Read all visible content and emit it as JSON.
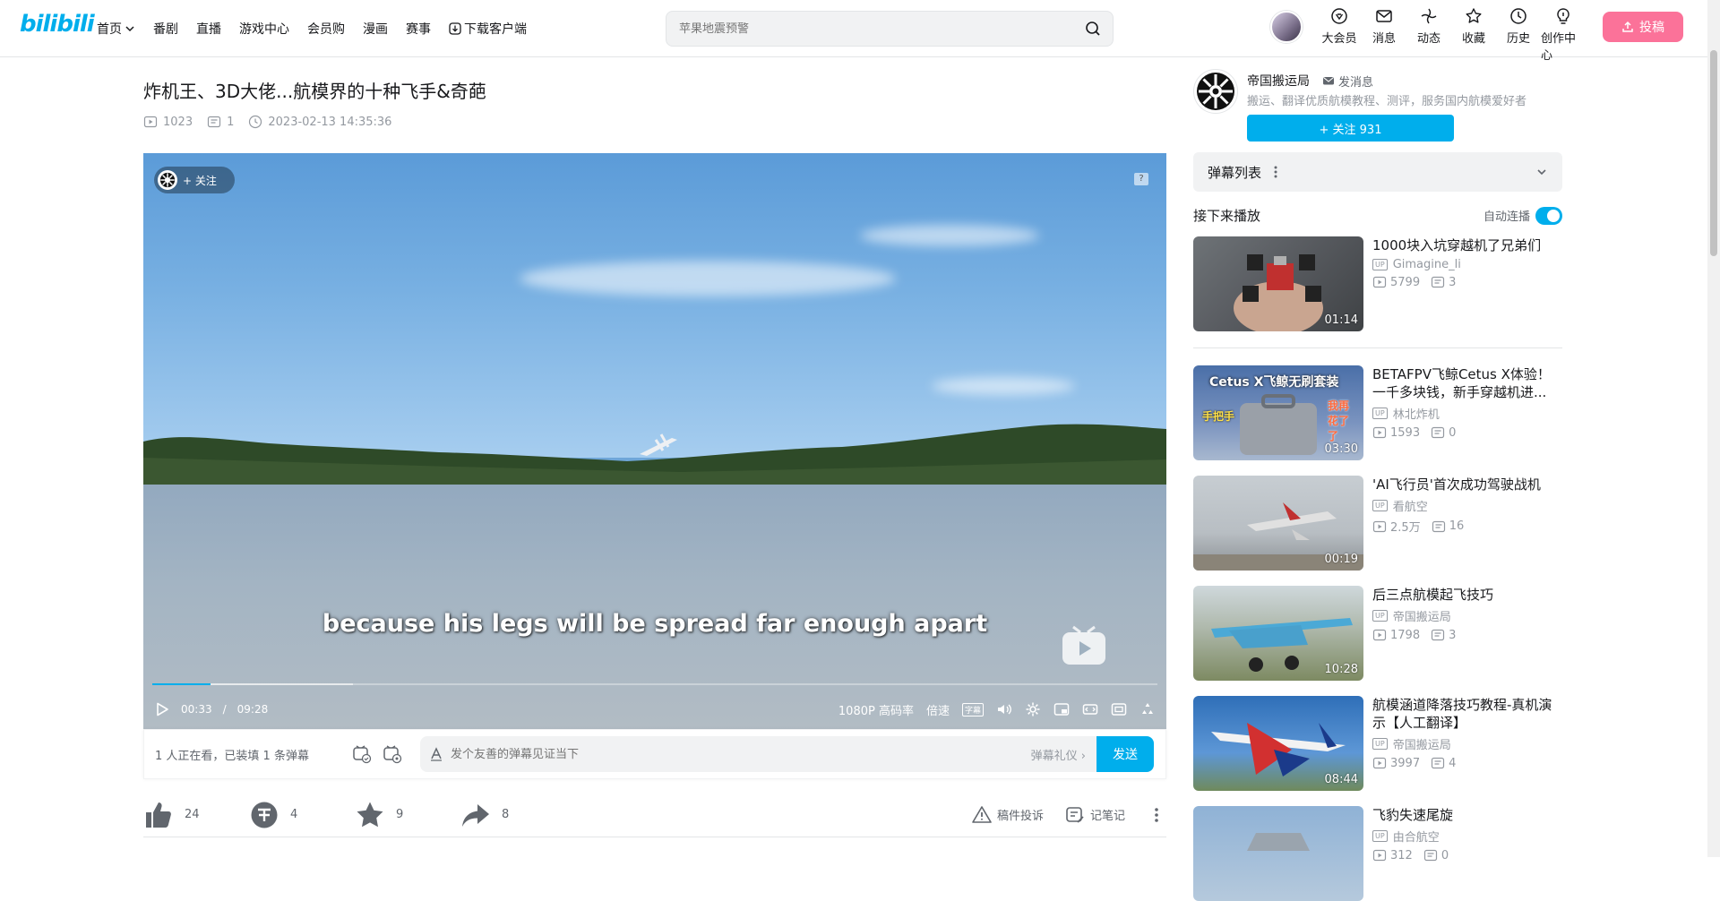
{
  "header": {
    "logo": "bilibili",
    "nav": [
      {
        "label": "首页",
        "has_arrow": true
      },
      {
        "label": "番剧"
      },
      {
        "label": "直播"
      },
      {
        "label": "游戏中心"
      },
      {
        "label": "会员购"
      },
      {
        "label": "漫画"
      },
      {
        "label": "赛事"
      },
      {
        "label": "下载客户端"
      }
    ],
    "search_placeholder": "苹果地震预警",
    "icons": [
      {
        "label": "大会员",
        "icon": "vip-icon"
      },
      {
        "label": "消息",
        "icon": "message-icon"
      },
      {
        "label": "动态",
        "icon": "dynamic-icon"
      },
      {
        "label": "收藏",
        "icon": "favorite-icon"
      },
      {
        "label": "历史",
        "icon": "history-icon"
      },
      {
        "label": "创作中心",
        "icon": "creator-icon"
      }
    ],
    "upload_label": "投稿"
  },
  "video": {
    "title": "炸机王、3D大佬...航模界的十种飞手&奇葩",
    "plays": "1023",
    "danmaku_count": "1",
    "date": "2023-02-13 14:35:36"
  },
  "player": {
    "follow_label": "+ 关注",
    "help_label": "?",
    "subtitle": "because his legs will be spread far enough apart",
    "current_time": "00:33",
    "separator": "/",
    "total_time": "09:28",
    "progress_fraction": 0.058,
    "buffer_fraction": 0.2,
    "quality": "1080P 高码率",
    "speed": "倍速",
    "subtitle_btn": "字幕"
  },
  "danmaku_bar": {
    "viewers": "1 人正在看，已装填 1 条弹幕",
    "placeholder": "发个友善的弹幕见证当下",
    "etiquette": "弹幕礼仪 ›",
    "send": "发送"
  },
  "actions": {
    "like": "24",
    "coin": "4",
    "favorite": "9",
    "share": "8",
    "report": "稿件投诉",
    "note": "记笔记"
  },
  "uploader": {
    "name": "帝国搬运局",
    "message": "发消息",
    "desc": "搬运、翻译优质航模教程、测评，服务国内航模爱好者",
    "follow": "+ 关注 931"
  },
  "sidebar": {
    "danmaku_list": "弹幕列表",
    "next_label": "接下来播放",
    "autoplay_label": "自动连播"
  },
  "recommendations": [
    {
      "title": "1000块入坑穿越机了兄弟们",
      "up": "Gimagine_li",
      "plays": "5799",
      "danmaku": "3",
      "duration": "01:14",
      "thumb": "red-drone"
    },
    {
      "title": "BETAFPV飞鲸Cetus X体验！一千多块钱，新手穿越机进...",
      "up": "林北炸机",
      "plays": "1593",
      "danmaku": "0",
      "duration": "03:30",
      "thumb": "cetus",
      "overlay": "Cetus X飞鲸无刷套装",
      "tag1": "手把手",
      "tag2": "我再花了了"
    },
    {
      "title": "'AI飞行员'首次成功驾驶战机",
      "up": "看航空",
      "plays": "2.5万",
      "danmaku": "16",
      "duration": "00:19",
      "thumb": "jet"
    },
    {
      "title": "后三点航模起飞技巧",
      "up": "帝国搬运局",
      "plays": "1798",
      "danmaku": "3",
      "duration": "10:28",
      "thumb": "cub"
    },
    {
      "title": "航模涵道降落技巧教程-真机演示【人工翻译】",
      "up": "帝国搬运局",
      "plays": "3997",
      "danmaku": "4",
      "duration": "08:44",
      "thumb": "edf"
    },
    {
      "title": "飞豹失速尾旋",
      "up": "由合航空",
      "plays": "312",
      "danmaku": "0",
      "duration": "",
      "thumb": "flanker"
    }
  ]
}
